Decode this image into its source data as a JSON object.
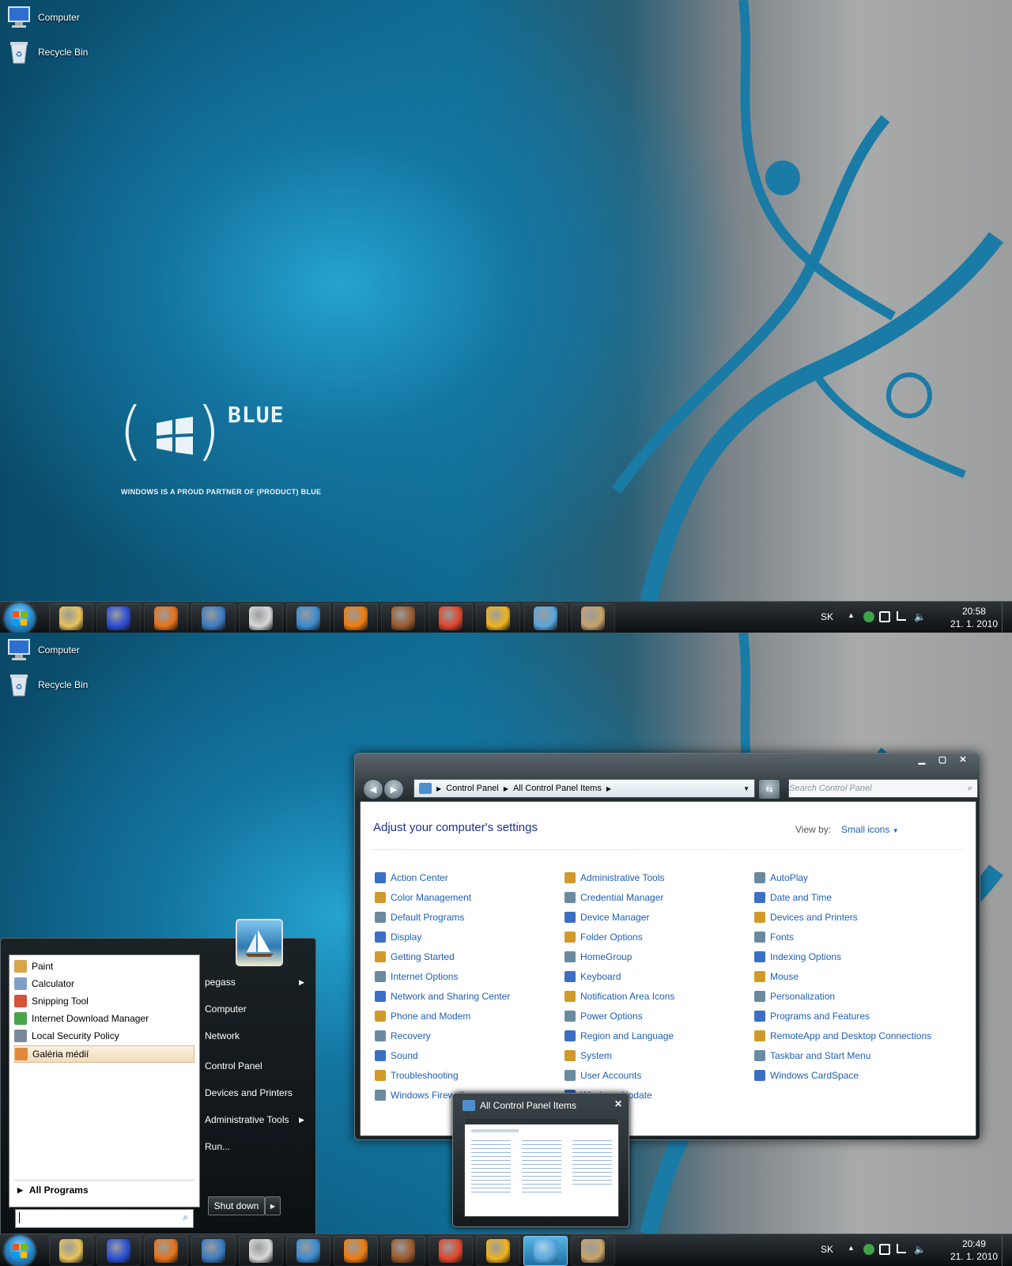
{
  "desktop_icons": [
    {
      "label": "Computer",
      "icon": "computer-icon"
    },
    {
      "label": "Recycle Bin",
      "icon": "recycle-bin-icon"
    }
  ],
  "wallpaper": {
    "brand_word": "BLUE",
    "tagline": "WINDOWS IS A PROUD PARTNER OF (PRODUCT) BLUE"
  },
  "taskbar_top": {
    "language": "SK",
    "time": "20:58",
    "date": "21. 1. 2010"
  },
  "taskbar_bottom": {
    "language": "SK",
    "time": "20:49",
    "date": "21. 1. 2010"
  },
  "taskbar_apps": [
    {
      "icon": "explorer-folder-icon",
      "color": "#e8c35a"
    },
    {
      "icon": "floppy-save-icon",
      "color": "#2b4fd6"
    },
    {
      "icon": "firefox-icon",
      "color": "#e7721b"
    },
    {
      "icon": "thunderbird-icon",
      "color": "#3b7cc2"
    },
    {
      "icon": "alien-skull-icon",
      "color": "#d9d9d9"
    },
    {
      "icon": "kmplayer-icon",
      "color": "#3a8bd1"
    },
    {
      "icon": "vlc-cone-icon",
      "color": "#f07c0f"
    },
    {
      "icon": "snail-icon",
      "color": "#9a5a2c"
    },
    {
      "icon": "nero-burn-icon",
      "color": "#e2452a"
    },
    {
      "icon": "winamp-icon",
      "color": "#f1b41e"
    },
    {
      "icon": "control-panel-icon",
      "color": "#5aa7dd"
    },
    {
      "icon": "paint-palette-icon",
      "color": "#c9a46a"
    }
  ],
  "start_menu": {
    "recent": [
      {
        "label": "Paint",
        "color": "#d8a54a"
      },
      {
        "label": "Calculator",
        "color": "#7fa0c4"
      },
      {
        "label": "Snipping Tool",
        "color": "#d4533b"
      },
      {
        "label": "Internet Download Manager",
        "color": "#4aa44a"
      },
      {
        "label": "Local Security Policy",
        "color": "#7a8a9a"
      },
      {
        "label": "Galéria médií",
        "color": "#e0893a"
      }
    ],
    "all_programs": "All Programs",
    "right_links": [
      {
        "label": "pegass",
        "arrow": true
      },
      {
        "label": "Computer",
        "arrow": false
      },
      {
        "label": "Network",
        "arrow": false
      },
      {
        "label": "Control Panel",
        "arrow": false
      },
      {
        "label": "Devices and Printers",
        "arrow": false
      },
      {
        "label": "Administrative Tools",
        "arrow": true
      },
      {
        "label": "Run...",
        "arrow": false
      }
    ],
    "shutdown_label": "Shut down"
  },
  "control_panel": {
    "breadcrumb": [
      "Control Panel",
      "All Control Panel Items"
    ],
    "search_placeholder": "Search Control Panel",
    "heading": "Adjust your computer's settings",
    "view_by_label": "View by:",
    "view_by_value": "Small icons",
    "columns": [
      [
        "Action Center",
        "Color Management",
        "Default Programs",
        "Display",
        "Getting Started",
        "Internet Options",
        "Network and Sharing Center",
        "Phone and Modem",
        "Recovery",
        "Sound",
        "Troubleshooting",
        "Windows Firewall"
      ],
      [
        "Administrative Tools",
        "Credential Manager",
        "Device Manager",
        "Folder Options",
        "HomeGroup",
        "Keyboard",
        "Notification Area Icons",
        "Power Options",
        "Region and Language",
        "System",
        "User Accounts",
        "Windows Update"
      ],
      [
        "AutoPlay",
        "Date and Time",
        "Devices and Printers",
        "Fonts",
        "Indexing Options",
        "Mouse",
        "Personalization",
        "Programs and Features",
        "RemoteApp and Desktop Connections",
        "Taskbar and Start Menu",
        "Windows CardSpace"
      ]
    ],
    "icon_colors": [
      "#3b6fc4",
      "#d09a2b",
      "#6a8aa0"
    ]
  },
  "thumbnail": {
    "title": "All Control Panel Items"
  }
}
